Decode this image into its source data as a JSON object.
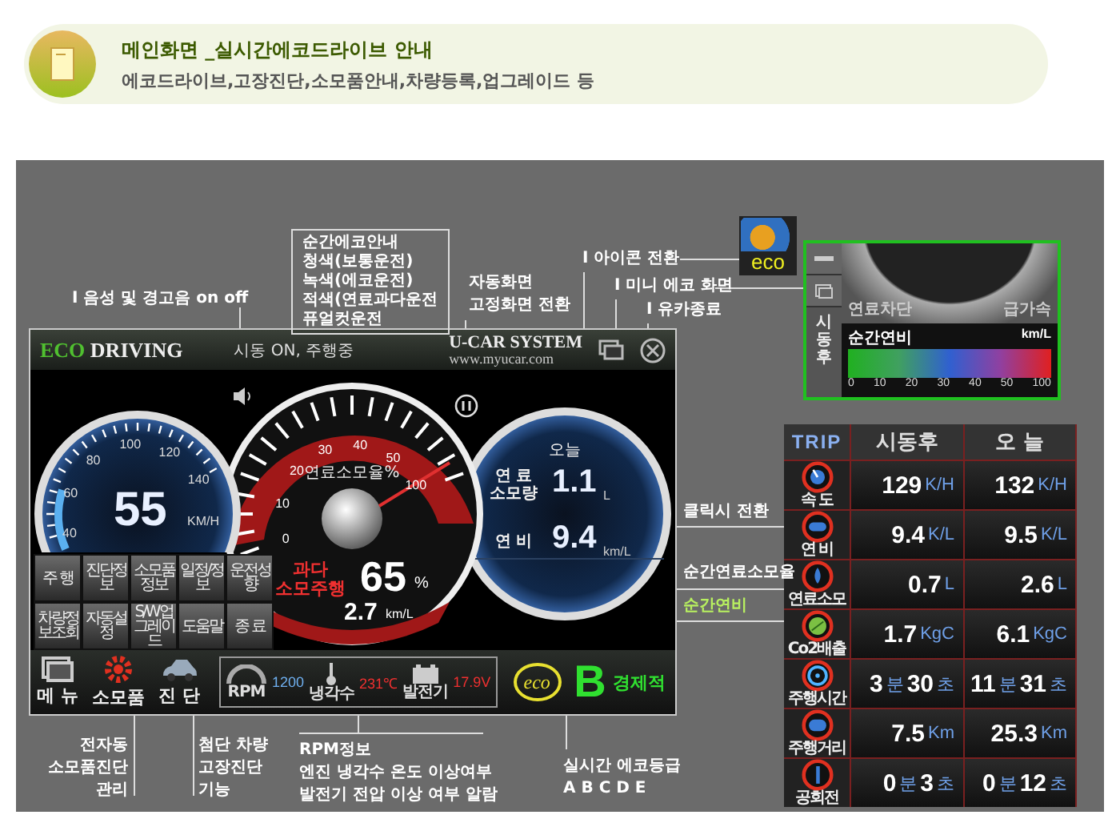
{
  "header": {
    "title": "메인화면 _실시간에코드라이브 안내",
    "subtitle": "에코드라이브,고장진단,소모품안내,차량등록,업그레이드 등"
  },
  "app": {
    "brand_highlight": "ECO",
    "brand": "DRIVING",
    "status": "시동 ON, 주행중",
    "system": "U-CAR SYSTEM",
    "url": "www.myucar.com",
    "speed_gauge": {
      "ticks": [
        "40",
        "60",
        "80",
        "100",
        "120",
        "140"
      ],
      "value": "55",
      "unit": "KM/H"
    },
    "fuel_gauge": {
      "title": "연료소모율%",
      "ticks": [
        "0",
        "10",
        "20",
        "30",
        "40",
        "50",
        "100"
      ],
      "warning": "과다 소모주행",
      "value": "65",
      "unit": "%",
      "economy": "2.7",
      "economy_unit": "km/L"
    },
    "today_gauge": {
      "title": "오늘",
      "rows": [
        {
          "label": "연 료 소모량",
          "value": "1.1",
          "unit": "L"
        },
        {
          "label": "연 비",
          "value": "9.4",
          "unit": "km/L"
        }
      ]
    },
    "tiles": [
      "주 행",
      "진단정보",
      "소모품정보",
      "일정/정보",
      "운전성향",
      "차량정보조회",
      "자동설정",
      "S/W업그레이드",
      "도움말",
      "종 료"
    ],
    "nav_buttons": [
      {
        "label": "메 뉴",
        "kind": "window"
      },
      {
        "label": "소모품",
        "kind": "gear"
      },
      {
        "label": "진 단",
        "kind": "car"
      }
    ],
    "status_box": {
      "rpm_label": "RPM",
      "rpm": "1200",
      "coolant": "231℃",
      "coolant_label": "냉각수",
      "voltage": "17.9V",
      "voltage_label": "발전기"
    },
    "eco_grade": {
      "logo": "eco",
      "grade": "B",
      "text": "경제적"
    }
  },
  "mini": {
    "icon_text": "eco",
    "cut": "연료차단",
    "accel": "급가속",
    "mode": "시동후",
    "label": "순간연비",
    "unit": "km/L",
    "ticks": [
      "0",
      "10",
      "20",
      "30",
      "40",
      "50",
      "100"
    ]
  },
  "trip": {
    "title": "TRIP",
    "columns": [
      "시동후",
      "오 늘"
    ],
    "rows": [
      {
        "label": "속 도",
        "kind": "speed",
        "cells": [
          [
            {
              "t": "129",
              "kind": "num"
            },
            {
              "t": "K/H",
              "kind": "unit"
            }
          ],
          [
            {
              "t": "132",
              "kind": "num"
            },
            {
              "t": "K/H",
              "kind": "unit"
            }
          ]
        ]
      },
      {
        "label": "연 비",
        "kind": "economy",
        "cells": [
          [
            {
              "t": "9.4",
              "kind": "num"
            },
            {
              "t": "K/L",
              "kind": "unit"
            }
          ],
          [
            {
              "t": "9.5",
              "kind": "num"
            },
            {
              "t": "K/L",
              "kind": "unit"
            }
          ]
        ]
      },
      {
        "label": "연료소모",
        "kind": "fuel",
        "cells": [
          [
            {
              "t": "0.7",
              "kind": "num"
            },
            {
              "t": "L",
              "kind": "unit"
            }
          ],
          [
            {
              "t": "2.6",
              "kind": "num"
            },
            {
              "t": "L",
              "kind": "unit"
            }
          ]
        ]
      },
      {
        "label": "Co2배출",
        "kind": "leaf",
        "cells": [
          [
            {
              "t": "1.7",
              "kind": "num"
            },
            {
              "t": "KgC",
              "kind": "unit"
            }
          ],
          [
            {
              "t": "6.1",
              "kind": "num"
            },
            {
              "t": "KgC",
              "kind": "unit"
            }
          ]
        ]
      },
      {
        "label": "주행시간",
        "kind": "clock",
        "cells": [
          [
            {
              "t": "3",
              "kind": "num"
            },
            {
              "t": "분",
              "kind": "unit"
            },
            {
              "t": "30",
              "kind": "num"
            },
            {
              "t": "초",
              "kind": "unit"
            }
          ],
          [
            {
              "t": "11",
              "kind": "num"
            },
            {
              "t": "분",
              "kind": "unit"
            },
            {
              "t": "31",
              "kind": "num"
            },
            {
              "t": "초",
              "kind": "unit"
            }
          ]
        ]
      },
      {
        "label": "주행거리",
        "kind": "distance",
        "cells": [
          [
            {
              "t": "7.5",
              "kind": "num"
            },
            {
              "t": "Km",
              "kind": "unit"
            }
          ],
          [
            {
              "t": "25.3",
              "kind": "num"
            },
            {
              "t": "Km",
              "kind": "unit"
            }
          ]
        ]
      },
      {
        "label": "공회전",
        "kind": "idle",
        "cells": [
          [
            {
              "t": "0",
              "kind": "num"
            },
            {
              "t": "분",
              "kind": "unit"
            },
            {
              "t": "3",
              "kind": "num"
            },
            {
              "t": "초",
              "kind": "unit"
            }
          ],
          [
            {
              "t": "0",
              "kind": "num"
            },
            {
              "t": "분",
              "kind": "unit"
            },
            {
              "t": "12",
              "kind": "num"
            },
            {
              "t": "초",
              "kind": "unit"
            }
          ]
        ]
      }
    ]
  },
  "annotations": [
    {
      "kind": "note",
      "lines": [
        "I 음성 및 경고음 on off"
      ]
    },
    {
      "kind": "boxed",
      "lines": [
        "순간에코안내",
        "청색(보통운전)",
        "녹색(에코운전)",
        "적색(연료과다운전",
        "퓨얼컷운전"
      ]
    },
    {
      "kind": "note",
      "lines": [
        "자동화면",
        "고정화면 전환"
      ]
    },
    {
      "kind": "note",
      "lines": [
        "I 아이콘 전환"
      ]
    },
    {
      "kind": "note",
      "lines": [
        "I 미니 에코 화면"
      ]
    },
    {
      "kind": "note",
      "lines": [
        "I 유카종료"
      ]
    },
    {
      "kind": "note",
      "lines": [
        "클릭시 전환"
      ]
    },
    {
      "kind": "note",
      "lines": [
        "순간연료소모율"
      ]
    },
    {
      "kind": "highlight",
      "lines": [
        "순간연비"
      ]
    },
    {
      "kind": "note",
      "lines": [
        "전자동",
        "소모품진단",
        "관리"
      ]
    },
    {
      "kind": "note",
      "lines": [
        "첨단 차량",
        "고장진단",
        "기능"
      ]
    },
    {
      "kind": "note",
      "lines": [
        "RPM정보",
        "엔진 냉각수 온도 이상여부",
        "발전기 전압 이상 여부 알람"
      ]
    },
    {
      "kind": "note",
      "lines": [
        "실시간 에코등급",
        "A B C D E"
      ]
    }
  ]
}
